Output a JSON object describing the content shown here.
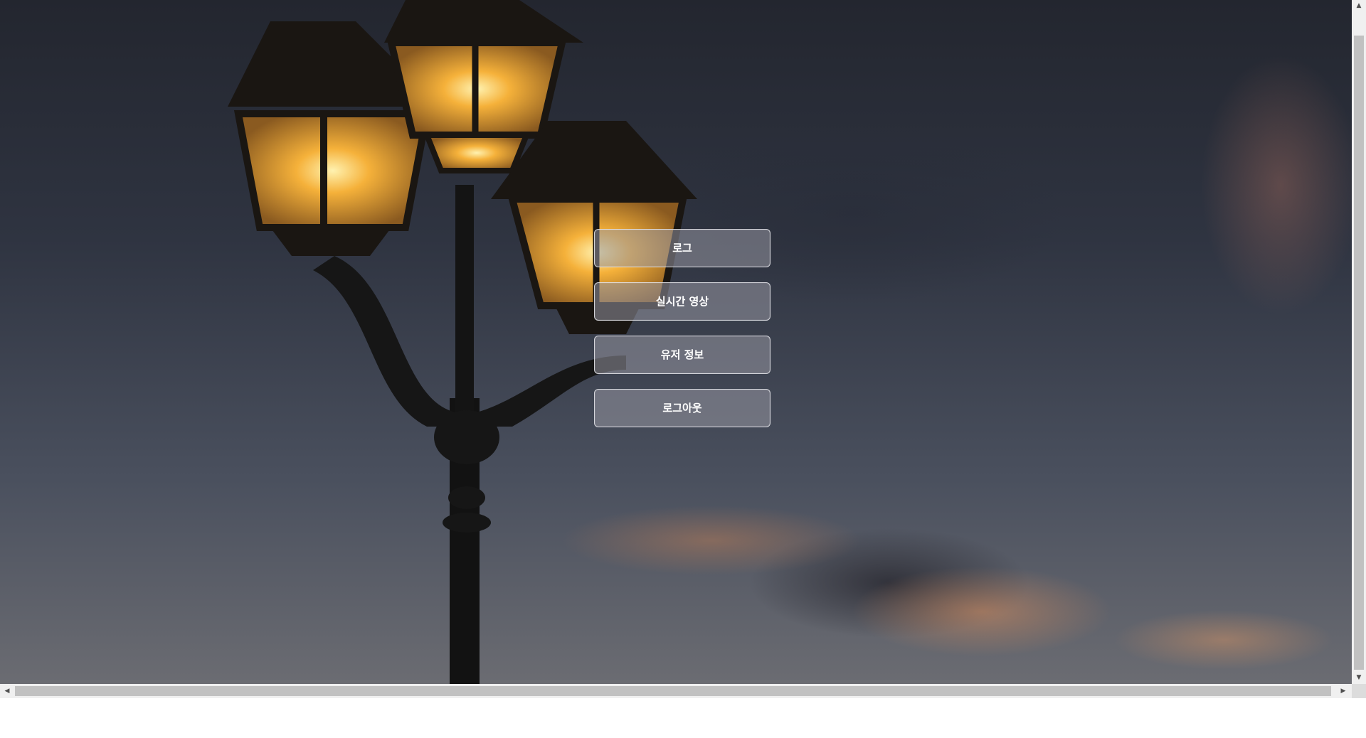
{
  "menu": {
    "items": [
      {
        "label": "로그"
      },
      {
        "label": "실시간 영상"
      },
      {
        "label": "유저 정보"
      },
      {
        "label": "로그아웃"
      }
    ]
  },
  "background": {
    "image": "street-lamp-at-dusk"
  },
  "scrollbars": {
    "up_icon": "▲",
    "down_icon": "▼",
    "left_icon": "◀",
    "right_icon": "▶"
  },
  "colors": {
    "button_bg": "#9696a0",
    "button_border": "#e6e6eb",
    "lamp_glow": "#f5b13a"
  }
}
